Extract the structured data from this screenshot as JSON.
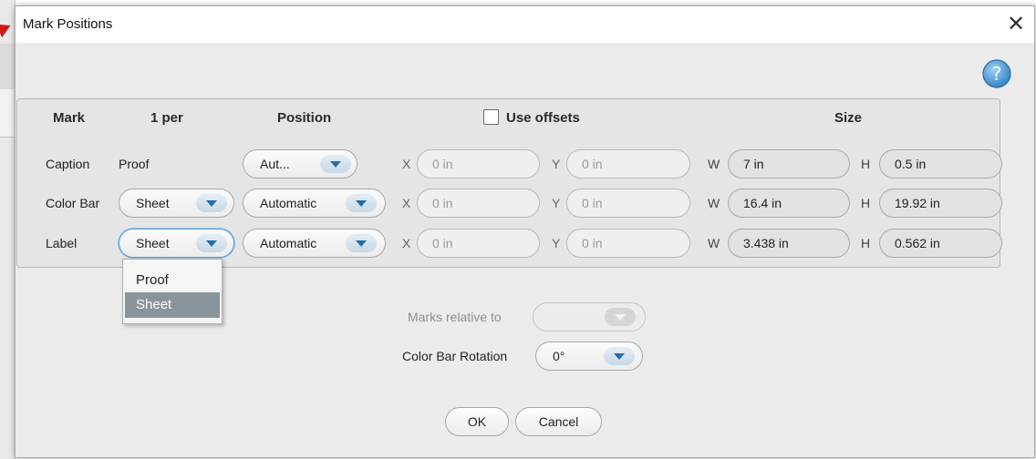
{
  "dialog": {
    "title": "Mark Positions",
    "close_glyph": "✕",
    "help_icon": "help-icon"
  },
  "headers": {
    "mark": "Mark",
    "per": "1 per",
    "position": "Position",
    "use_offsets": "Use offsets",
    "size": "Size"
  },
  "use_offsets_checked": false,
  "rows": [
    {
      "label": "Caption",
      "per": "Proof",
      "position": "Aut...",
      "x_label": "X",
      "x": "0 in",
      "y_label": "Y",
      "y": "0 in",
      "w_label": "W",
      "w": "7 in",
      "h_label": "H",
      "h": "0.5 in"
    },
    {
      "label": "Color Bar",
      "per": "Sheet",
      "position": "Automatic",
      "x_label": "X",
      "x": "0 in",
      "y_label": "Y",
      "y": "0 in",
      "w_label": "W",
      "w": "16.4 in",
      "h_label": "H",
      "h": "19.92 in"
    },
    {
      "label": "Label",
      "per": "Sheet",
      "position": "Automatic",
      "x_label": "X",
      "x": "0 in",
      "y_label": "Y",
      "y": "0 in",
      "w_label": "W",
      "w": "3.438 in",
      "h_label": "H",
      "h": "0.562 in"
    }
  ],
  "dropdown": {
    "options": [
      "Proof",
      "Sheet"
    ],
    "selected": "Sheet"
  },
  "marks_relative_to": {
    "label": "Marks relative to",
    "value": ""
  },
  "rotation": {
    "label": "Color Bar Rotation",
    "value": "0°"
  },
  "buttons": {
    "ok": "OK",
    "cancel": "Cancel"
  },
  "colors": {
    "accent": "#1f6fae",
    "selection": "#8a949c",
    "dialog_bg": "#ebebeb",
    "arrow": "#d01818"
  }
}
